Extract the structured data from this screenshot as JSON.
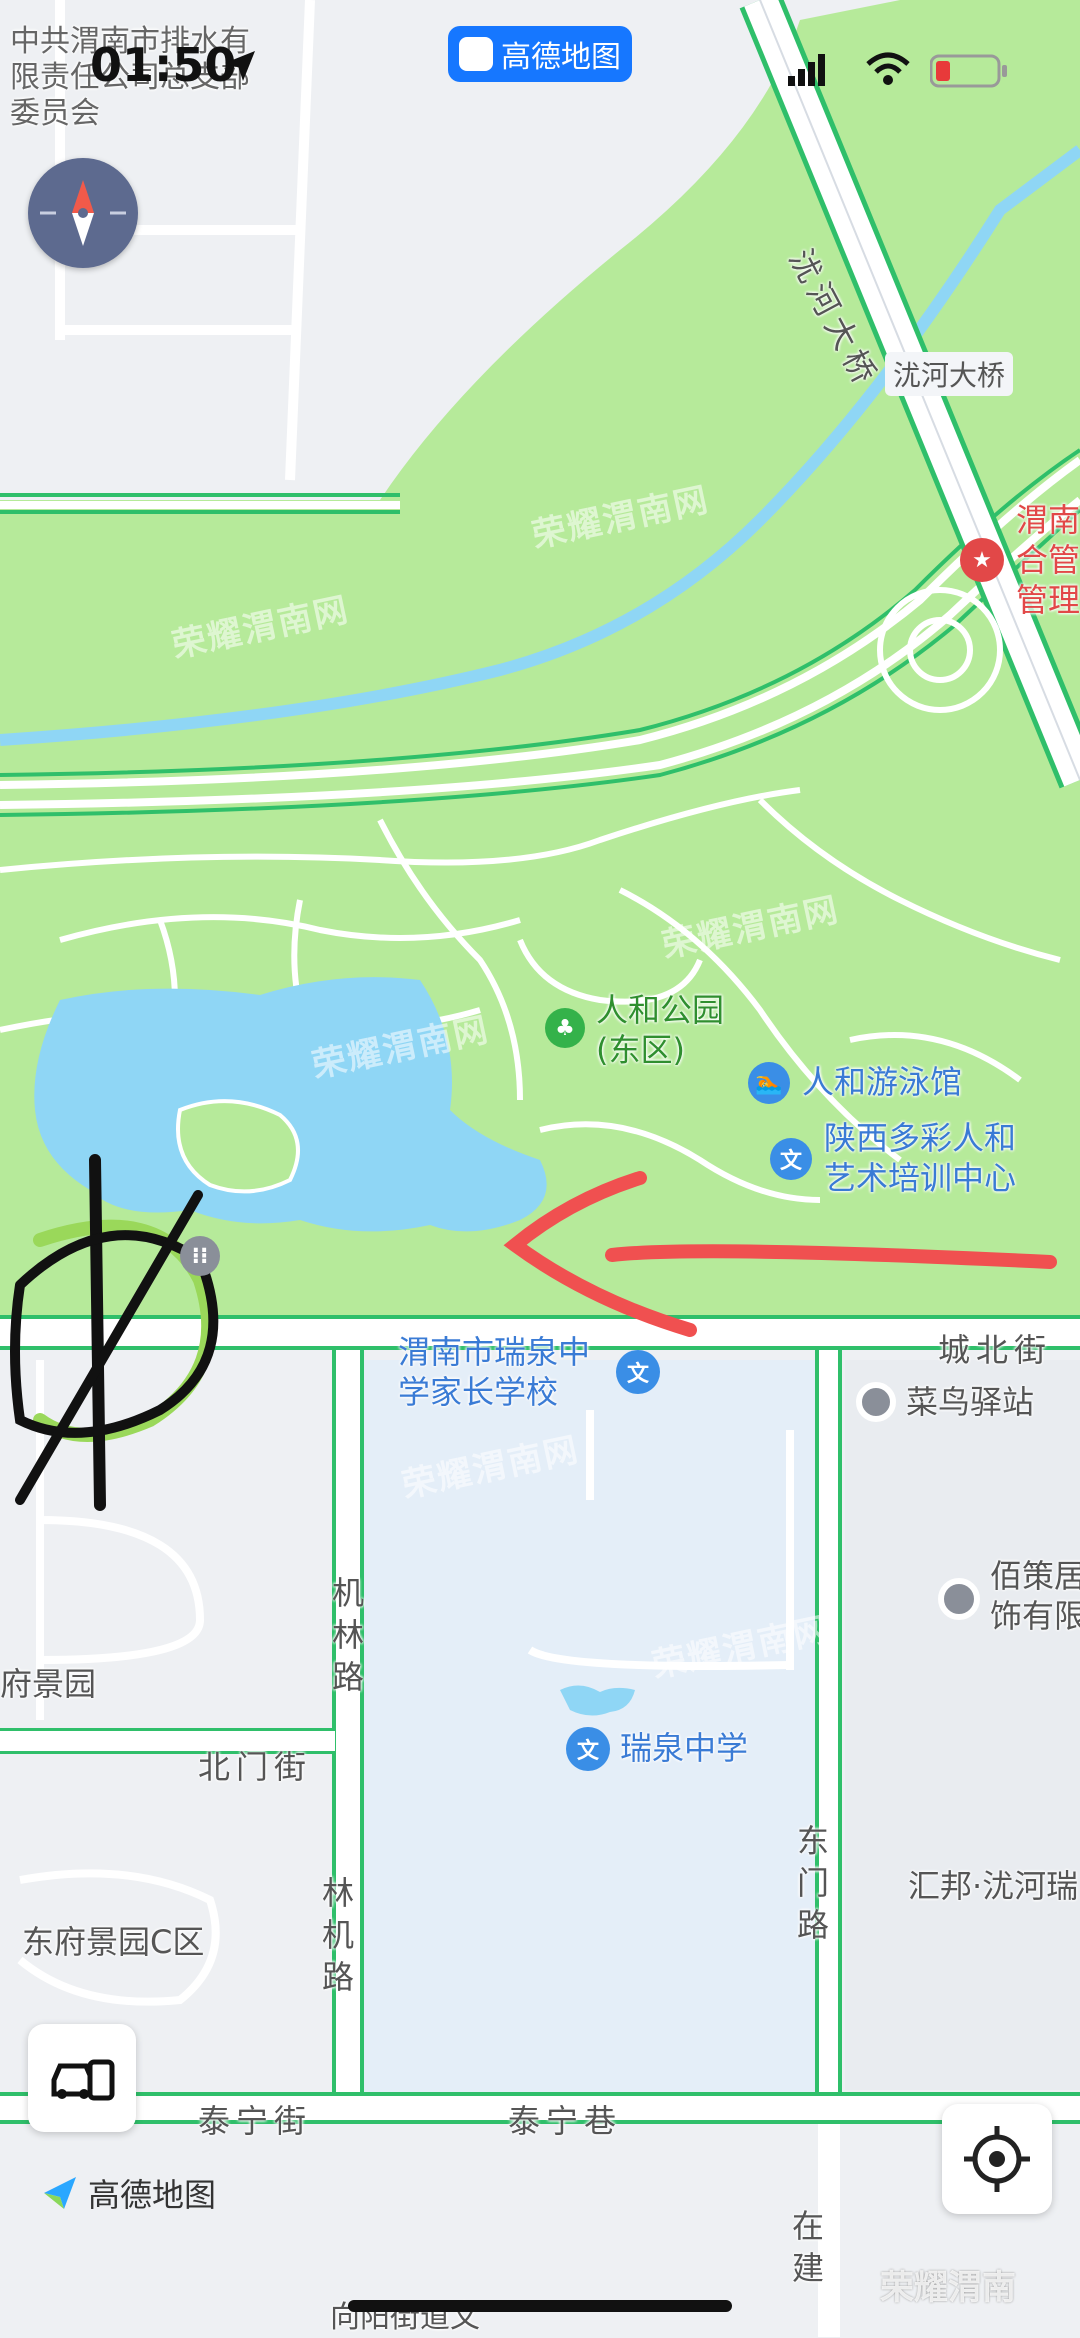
{
  "status_bar": {
    "time": "01:50",
    "app_badge": "高德地图",
    "top_left_label": "中共渭南市排水有限责任公司总支部委员会"
  },
  "map": {
    "roads": {
      "chengbei_jie": "城北街",
      "beimen_jie": "北门街",
      "taining_jie": "泰宁街",
      "taining_xiang": "泰宁巷",
      "jilin_lu": "机林路",
      "linji_lu": "林机路",
      "dongmen_lu": "东门路",
      "bridge_label_rotated": "沋河大桥",
      "bridge_label_box": "沋河大桥",
      "zaijian": "在建",
      "xiangyang": "向阳街道文"
    },
    "pois": {
      "park": "人和公园(东区)",
      "pool": "人和游泳馆",
      "art_center": "陕西多彩人和艺术培训中心",
      "parents_school": "渭南市瑞泉中学家长学校",
      "cainiao": "菜鸟驿站",
      "ruiquan_school": "瑞泉中学",
      "baice": "佰策居饰有限",
      "huibang": "汇邦·沋河瑞",
      "dongfu_c": "东府景园C区",
      "fujingyuan": "府景园",
      "weinan_right": "渭南合管管理"
    },
    "watermark": "荣耀渭南网",
    "colors": {
      "park": "#b6ea9a",
      "water": "#8fd6f5",
      "road_green": "#2fbf6a",
      "block": "#e4eef8"
    }
  },
  "controls": {
    "compass": "compass-icon",
    "car_button": "car-phone-icon",
    "locate_button": "locate-icon",
    "logo_text": "高德地图"
  },
  "footer_watermark": "荣耀渭南"
}
